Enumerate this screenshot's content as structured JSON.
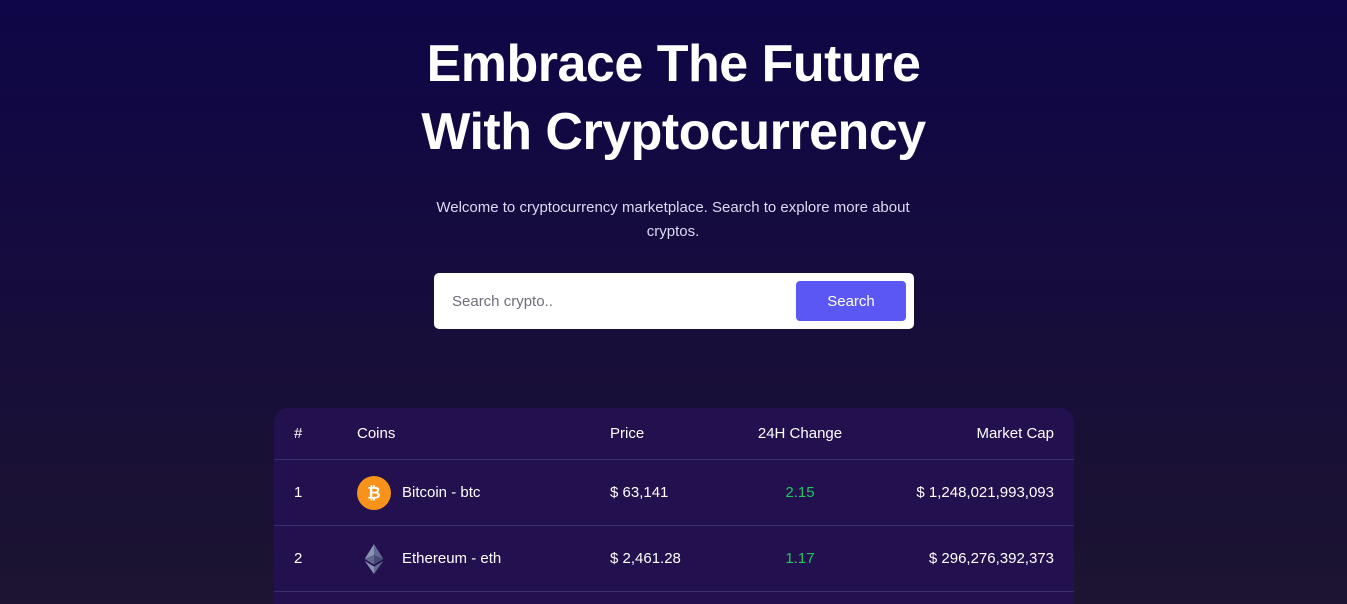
{
  "hero": {
    "title_line1": "Embrace The Future",
    "title_line2": "With Cryptocurrency",
    "subtitle": "Welcome to cryptocurrency marketplace. Search to explore more about cryptos."
  },
  "search": {
    "placeholder": "Search crypto..",
    "button_label": "Search"
  },
  "table": {
    "headers": {
      "rank": "#",
      "coins": "Coins",
      "price": "Price",
      "change": "24H Change",
      "market_cap": "Market Cap"
    },
    "rows": [
      {
        "rank": "1",
        "coin": "Bitcoin - btc",
        "icon": "bitcoin-icon",
        "price": "$ 63,141",
        "change": "2.15",
        "market_cap": "$ 1,248,021,993,093"
      },
      {
        "rank": "2",
        "coin": "Ethereum - eth",
        "icon": "ethereum-icon",
        "price": "$ 2,461.28",
        "change": "1.17",
        "market_cap": "$ 296,276,392,373"
      }
    ]
  },
  "colors": {
    "accent": "#5a57f5",
    "positive": "#22c55e",
    "table_bg": "#22104f",
    "bitcoin": "#f7931a"
  }
}
